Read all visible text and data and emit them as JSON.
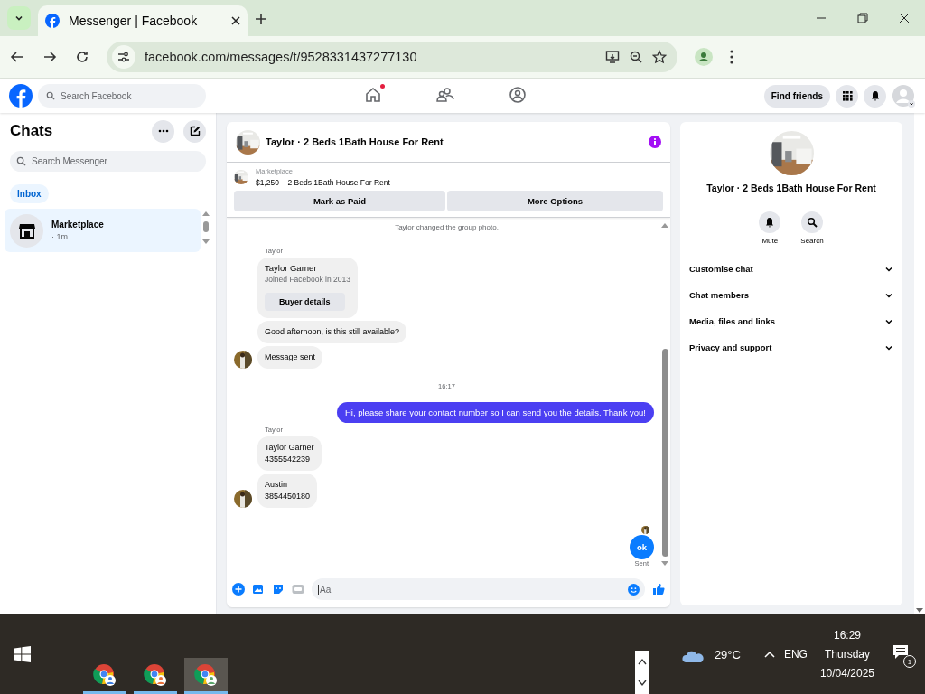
{
  "browser": {
    "tab_title": "Messenger | Facebook",
    "url": "facebook.com/messages/t/9528331437277130"
  },
  "fb_header": {
    "search_placeholder": "Search Facebook",
    "nav": [
      {
        "kind": "home",
        "dot": true
      },
      {
        "kind": "friends",
        "dot": false
      },
      {
        "kind": "groups",
        "dot": false
      }
    ],
    "find_friends": "Find friends"
  },
  "sidebar": {
    "title": "Chats",
    "search_placeholder": "Search Messenger",
    "filters": [
      {
        "label": "Inbox",
        "selected": true
      }
    ],
    "chats": [
      {
        "name": "Marketplace",
        "time": "· 1m",
        "selected": true
      }
    ]
  },
  "chat": {
    "title": "Taylor · 2 Beds 1Bath House For Rent",
    "listing": {
      "source": "Marketplace",
      "title": "$1,250 – 2 Beds 1Bath House For Rent"
    },
    "actions": [
      "Mark as Paid",
      "More Options"
    ],
    "messages": [
      {
        "kind": "event",
        "text": "Taylor changed the group photo."
      },
      {
        "kind": "sender",
        "text": "Taylor"
      },
      {
        "kind": "profile_card",
        "name": "Taylor Garner",
        "subtitle": "Joined Facebook in 2013",
        "button": "Buyer details"
      },
      {
        "kind": "incoming",
        "lines": [
          "Good afternoon, is this still available?"
        ],
        "avatar": false
      },
      {
        "kind": "incoming",
        "lines": [
          "Message sent"
        ],
        "avatar": true
      },
      {
        "kind": "timestamp",
        "text": "16:17"
      },
      {
        "kind": "outgoing",
        "lines": [
          "Hi, please share your contact number so I can send you the details. Thank you!"
        ],
        "color": "#4b3ff2"
      },
      {
        "kind": "sender",
        "text": "Taylor"
      },
      {
        "kind": "incoming",
        "lines": [
          "Taylor Garner",
          "4355542239"
        ],
        "avatar": false
      },
      {
        "kind": "incoming",
        "lines": [
          "Austin",
          "3854450180"
        ],
        "avatar": true
      },
      {
        "kind": "seen"
      },
      {
        "kind": "outgoing",
        "lines": [
          "ok"
        ],
        "color": "#0a7cff"
      },
      {
        "kind": "status",
        "text": "Sent"
      }
    ],
    "composer_placeholder": "Aa"
  },
  "info": {
    "title": "Taylor · 2 Beds 1Bath House For Rent",
    "actions": [
      {
        "kind": "bell",
        "label": "Mute"
      },
      {
        "kind": "search",
        "label": "Search"
      }
    ],
    "sections": [
      "Customise chat",
      "Chat members",
      "Media, files and links",
      "Privacy and support"
    ]
  },
  "taskbar": {
    "apps": [
      {
        "color": "#3b7be0",
        "selected": false
      },
      {
        "color": "#e8703a",
        "selected": false
      },
      {
        "color": "#5aa469",
        "selected": true
      }
    ],
    "temperature": "29°C",
    "language": "ENG",
    "time": "16:29",
    "day": "Thursday",
    "date": "10/04/2025",
    "notifications": "1"
  }
}
